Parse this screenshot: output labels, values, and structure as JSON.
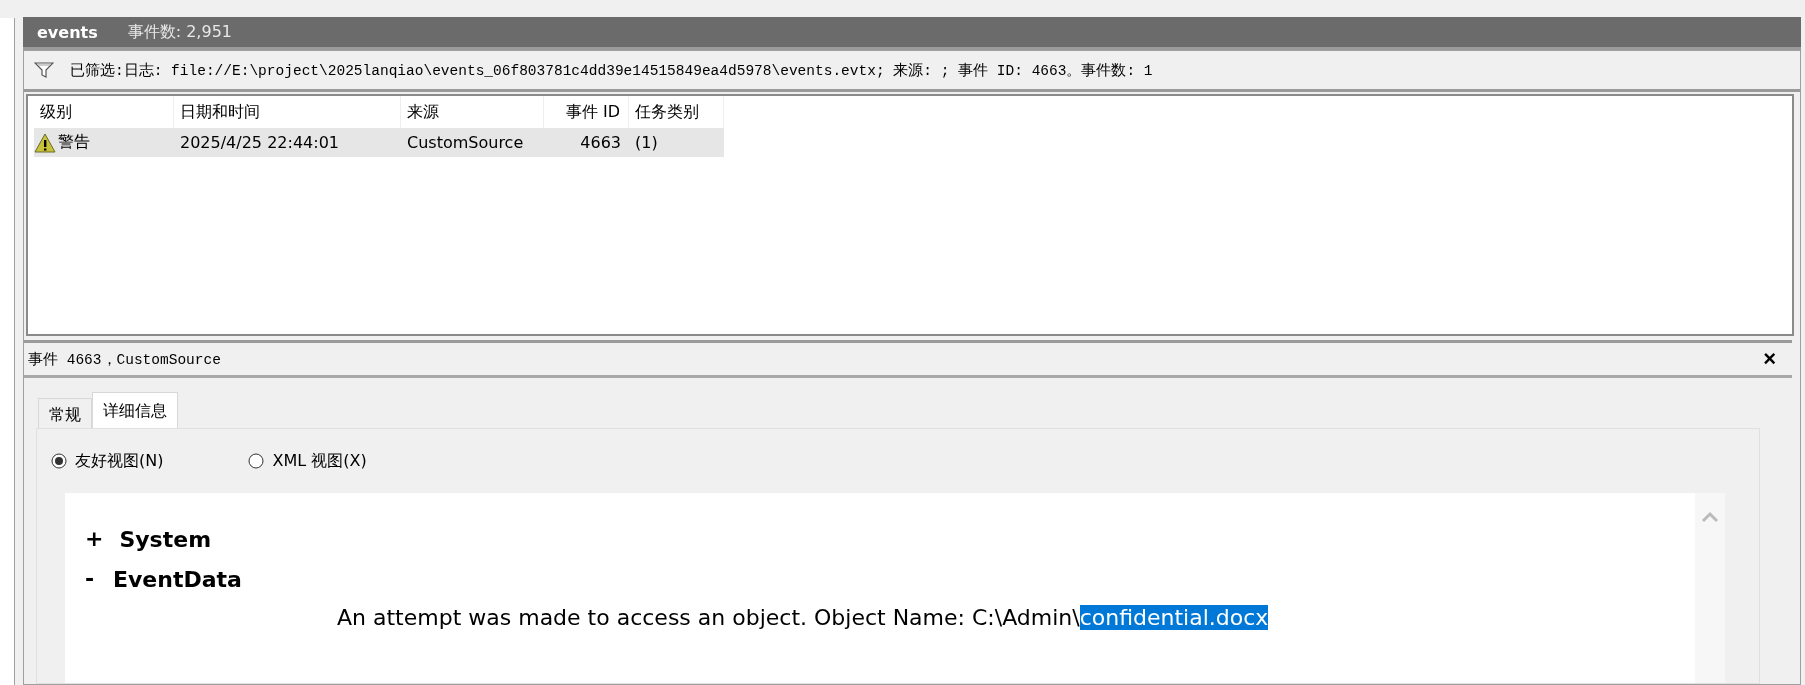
{
  "header": {
    "title": "events",
    "count": "事件数: 2,951"
  },
  "filter": {
    "text": "已筛选:日志: file://E:\\project\\2025lanqiao\\events_06f803781c4dd39e14515849ea4d5978\\events.evtx; 来源: ; 事件 ID: 4663。事件数: 1"
  },
  "table": {
    "columns": [
      "级别",
      "日期和时间",
      "来源",
      "事件 ID",
      "任务类别"
    ],
    "rows": [
      {
        "kind": "warning",
        "selected": true,
        "cells": [
          "警告",
          "2025/4/25 22:44:01",
          "CustomSource",
          "4663",
          "(1)"
        ]
      }
    ]
  },
  "detail": {
    "title": "事件 4663，CustomSource",
    "close": "×",
    "tabs": [
      {
        "label": "常规",
        "selected": false
      },
      {
        "label": "详细信息",
        "selected": true
      }
    ],
    "views": [
      {
        "label": "友好视图(N)",
        "selected": true
      },
      {
        "label": "XML 视图(X)",
        "selected": false
      }
    ],
    "tree": [
      {
        "toggle": "+",
        "label": "System"
      },
      {
        "toggle": "-",
        "label": "EventData",
        "lines": [
          {
            "text": "An attempt was made to access an object. Object Name: C:\\Admin\\",
            "selected_text": "confidential.docx"
          }
        ]
      }
    ]
  }
}
